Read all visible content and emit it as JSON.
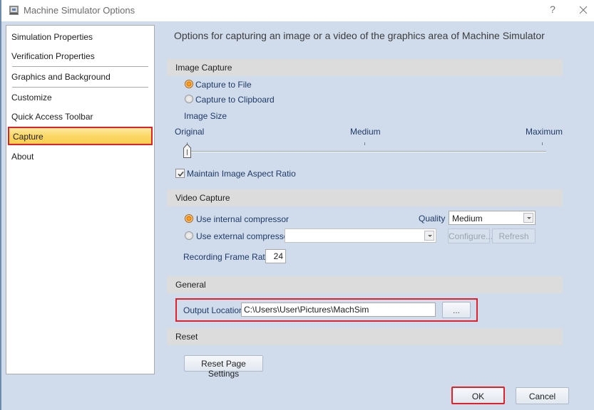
{
  "window": {
    "title": "Machine Simulator Options",
    "help_label": "?",
    "icons": {
      "app": "machine-simulator-icon",
      "close": "close-icon"
    }
  },
  "nav": {
    "items": [
      {
        "label": "Simulation Properties"
      },
      {
        "label": "Verification Properties"
      },
      {
        "label": "Graphics and Background"
      },
      {
        "label": "Customize"
      },
      {
        "label": "Quick Access Toolbar"
      },
      {
        "label": "Capture",
        "selected": true
      },
      {
        "label": "About"
      }
    ]
  },
  "page": {
    "header": "Options for capturing an image or a video of the graphics area of Machine Simulator",
    "image_capture": {
      "title": "Image Capture",
      "capture_to_file": {
        "label": "Capture to File",
        "checked": true
      },
      "capture_to_clipboard": {
        "label": "Capture to Clipboard",
        "checked": false
      },
      "image_size_label": "Image Size",
      "slider": {
        "labels": [
          "Original",
          "Medium",
          "Maximum"
        ],
        "value_label": "Original",
        "value_fraction": 0.0
      },
      "maintain_aspect": {
        "label": "Maintain Image Aspect Ratio",
        "checked": true
      }
    },
    "video_capture": {
      "title": "Video Capture",
      "use_internal": {
        "label": "Use internal compressor",
        "checked": true
      },
      "use_external": {
        "label": "Use external compressor",
        "checked": false
      },
      "external_value": "",
      "quality_label": "Quality",
      "quality_value": "Medium",
      "configure_label": "Configure...",
      "refresh_label": "Refresh",
      "frame_rate_label": "Recording Frame Rate",
      "frame_rate_value": "24"
    },
    "general": {
      "title": "General",
      "output_location_label": "Output Location",
      "output_location_value": "C:\\Users\\User\\Pictures\\MachSim",
      "browse_label": "..."
    },
    "reset": {
      "title": "Reset",
      "reset_button_label": "Reset Page Settings"
    }
  },
  "footer": {
    "ok_label": "OK",
    "cancel_label": "Cancel"
  },
  "colors": {
    "background": "#d0dcec",
    "highlight_outline": "#e2202a",
    "selected_item": "#fbd866",
    "section_bar": "#dcdcdc"
  }
}
